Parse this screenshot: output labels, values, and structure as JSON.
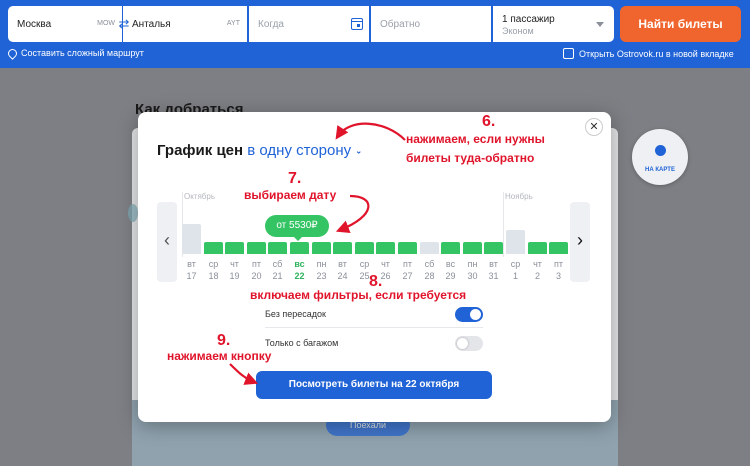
{
  "search": {
    "from": "Москва",
    "from_code": "MOW",
    "to": "Анталья",
    "to_code": "AYT",
    "when_placeholder": "Когда",
    "return_placeholder": "Обратно",
    "passengers": "1 пассажир",
    "class": "Эконом",
    "find_button": "Найти билеты",
    "complex_route": "Составить сложный маршрут",
    "ostrovok": "Открыть Ostrovok.ru в новой вкладке"
  },
  "background": {
    "title": "Как добраться",
    "map_button": "НА КАРТЕ",
    "bottom_button": "Поехали"
  },
  "modal": {
    "title": "График цен",
    "direction": "в одну сторону",
    "month_left": "Октябрь",
    "month_right": "Ноябрь",
    "price_bubble": "от 5530₽",
    "days": [
      {
        "dow": "вт",
        "dom": "17",
        "level": 0.75,
        "available": false
      },
      {
        "dow": "ср",
        "dom": "18",
        "level": 0.3,
        "available": true
      },
      {
        "dow": "чт",
        "dom": "19",
        "level": 0.3,
        "available": true
      },
      {
        "dow": "пт",
        "dom": "20",
        "level": 0.3,
        "available": true
      },
      {
        "dow": "сб",
        "dom": "21",
        "level": 0.3,
        "available": true
      },
      {
        "dow": "вс",
        "dom": "22",
        "level": 0.3,
        "available": true,
        "selected": true
      },
      {
        "dow": "пн",
        "dom": "23",
        "level": 0.3,
        "available": true
      },
      {
        "dow": "вт",
        "dom": "24",
        "level": 0.3,
        "available": true
      },
      {
        "dow": "ср",
        "dom": "25",
        "level": 0.3,
        "available": true
      },
      {
        "dow": "чт",
        "dom": "26",
        "level": 0.3,
        "available": true
      },
      {
        "dow": "пт",
        "dom": "27",
        "level": 0.3,
        "available": true
      },
      {
        "dow": "сб",
        "dom": "28",
        "level": 0.3,
        "available": false
      },
      {
        "dow": "вс",
        "dom": "29",
        "level": 0.3,
        "available": true
      },
      {
        "dow": "пн",
        "dom": "30",
        "level": 0.3,
        "available": true
      },
      {
        "dow": "вт",
        "dom": "31",
        "level": 0.3,
        "available": true
      },
      {
        "dow": "ср",
        "dom": "1",
        "level": 0.6,
        "available": false
      },
      {
        "dow": "чт",
        "dom": "2",
        "level": 0.3,
        "available": true
      },
      {
        "dow": "пт",
        "dom": "3",
        "level": 0.3,
        "available": true
      }
    ],
    "filter_direct": "Без пересадок",
    "filter_direct_on": true,
    "filter_baggage": "Только с багажом",
    "filter_baggage_on": false,
    "cta": "Посмотреть билеты на 22 октября"
  },
  "annotations": {
    "n6": "6.",
    "t6": "нажимаем, если нужны\nбилеты туда-обратно",
    "n7": "7.",
    "t7": "выбираем дату",
    "n8": "8.",
    "t8": "включаем фильтры, если требуется",
    "n9": "9.",
    "t9": "нажимаем кнопку"
  },
  "colors": {
    "brand_blue": "#1f63d6",
    "find_orange": "#f0652e",
    "price_green": "#34c464",
    "annotation_red": "#e0142b"
  },
  "icons": [
    "swap-icon",
    "calendar-icon",
    "route-icon",
    "close-icon",
    "chevron-left-icon",
    "chevron-right-icon",
    "globe-icon"
  ]
}
